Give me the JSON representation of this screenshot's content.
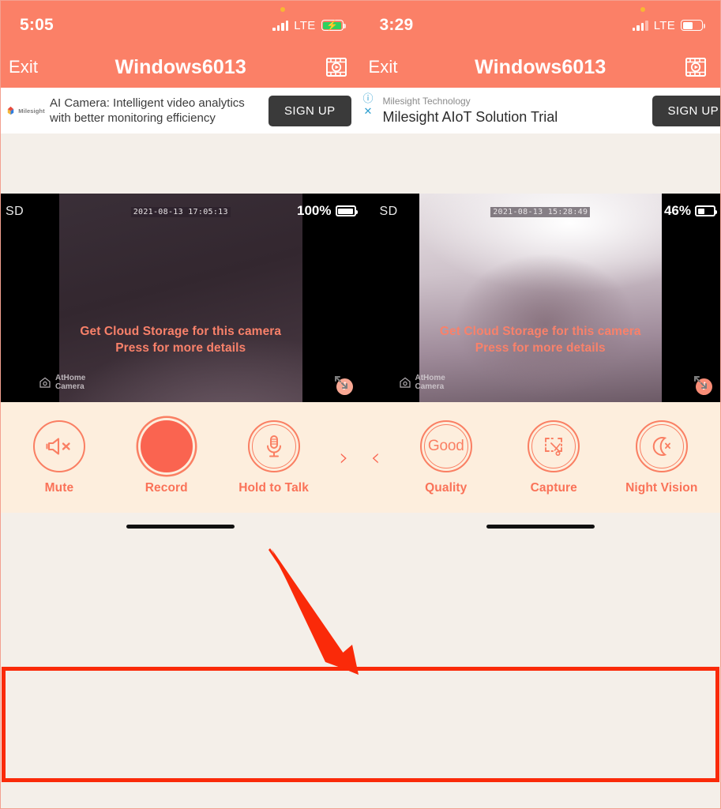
{
  "panels": [
    {
      "id": "left",
      "status": {
        "clock": "5:05",
        "network": "LTE",
        "battery_state": "charging"
      },
      "nav": {
        "exit_label": "Exit",
        "title": "Windows6013",
        "right_icon": "film-play-icon"
      },
      "ad": {
        "advertiser_logo": "milesight-logo",
        "advertiser_name": "Milesight",
        "headline": "AI Camera: Intelligent video analytics with better monitoring efficiency",
        "cta": "SIGN UP"
      },
      "video": {
        "quality_badge": "SD",
        "timestamp": "2021-08-13 17:05:13",
        "battery_percent": "100%",
        "watermark_line1": "AtHome",
        "watermark_line2": "Camera",
        "expand_icon": "fullscreen-icon"
      },
      "cloud_promo": {
        "line1": "Get Cloud Storage for this camera",
        "line2": "Press for more details"
      },
      "toolbar": {
        "page": 1,
        "items": [
          {
            "icon": "speaker-muted-icon",
            "label": "Mute",
            "style": "outline"
          },
          {
            "icon": "record-dot-icon",
            "label": "Record",
            "style": "filled"
          },
          {
            "icon": "microphone-icon",
            "label": "Hold to Talk",
            "style": "outline-double"
          }
        ],
        "next_arrow": "›",
        "prev_arrow": null
      }
    },
    {
      "id": "right",
      "status": {
        "clock": "3:29",
        "network": "LTE",
        "battery_state": "partial"
      },
      "nav": {
        "exit_label": "Exit",
        "title": "Windows6013",
        "right_icon": "film-play-icon"
      },
      "ad": {
        "advertiser_logo": "info-close-badges",
        "advertiser_name": "Milesight Technology",
        "headline": "Milesight AIoT Solution Trial",
        "cta": "SIGN UP"
      },
      "video": {
        "quality_badge": "SD",
        "timestamp": "2021-08-13 15:28:49",
        "battery_percent": "46%",
        "watermark_line1": "AtHome",
        "watermark_line2": "Camera",
        "expand_icon": "fullscreen-icon"
      },
      "cloud_promo": {
        "line1": "Get Cloud Storage for this camera",
        "line2": "Press for more details"
      },
      "toolbar": {
        "page": 2,
        "items": [
          {
            "icon": "quality-good-icon",
            "label": "Quality",
            "value": "Good",
            "style": "outline-double"
          },
          {
            "icon": "capture-crop-icon",
            "label": "Capture",
            "style": "outline-double"
          },
          {
            "icon": "moon-off-icon",
            "label": "Night Vision",
            "style": "outline-double"
          }
        ],
        "next_arrow": null,
        "prev_arrow": "‹"
      }
    }
  ],
  "annotation": {
    "arrow_color": "#fa2a09",
    "highlight_color": "#fa2a09",
    "target": "control-toolbar"
  },
  "colors": {
    "header": "#fb8067",
    "accent": "#fa7258",
    "toolbar_bg": "#fdeedd",
    "page_bg": "#f4efe9",
    "annotation_red": "#fa2a09"
  }
}
